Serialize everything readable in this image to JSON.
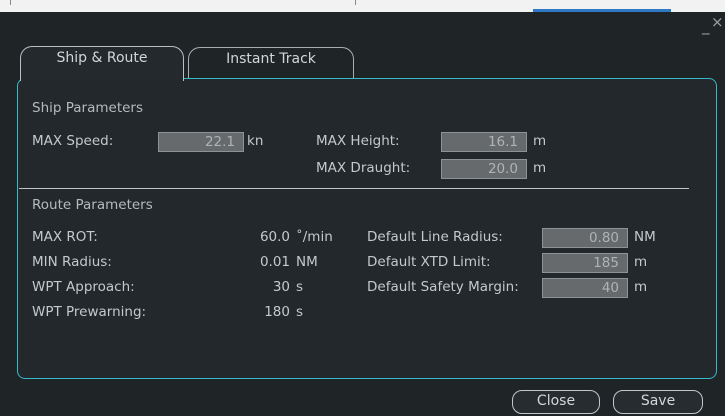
{
  "window": {
    "minimize_glyph": "_",
    "close_glyph": "×"
  },
  "tabs": [
    {
      "label": "Ship & Route",
      "active": true
    },
    {
      "label": "Instant Track",
      "active": false
    }
  ],
  "ship": {
    "section_title": "Ship Parameters",
    "max_speed": {
      "label": "MAX Speed:",
      "value": "22.1",
      "unit": "kn"
    },
    "max_height": {
      "label": "MAX Height:",
      "value": "16.1",
      "unit": "m"
    },
    "max_draught": {
      "label": "MAX Draught:",
      "value": "20.0",
      "unit": "m"
    }
  },
  "route": {
    "section_title": "Route Parameters",
    "max_rot": {
      "label": "MAX ROT:",
      "value": "60.0",
      "unit": "˚/min"
    },
    "min_radius": {
      "label": "MIN Radius:",
      "value": "0.01",
      "unit": "NM"
    },
    "wpt_approach": {
      "label": "WPT Approach:",
      "value": "30",
      "unit": "s"
    },
    "wpt_prewarning": {
      "label": "WPT Prewarning:",
      "value": "180",
      "unit": "s"
    },
    "default_line_radius": {
      "label": "Default Line Radius:",
      "value": "0.80",
      "unit": "NM"
    },
    "default_xtd_limit": {
      "label": "Default XTD Limit:",
      "value": "185",
      "unit": "m"
    },
    "default_safety_margin": {
      "label": "Default Safety Margin:",
      "value": "40",
      "unit": "m"
    }
  },
  "buttons": {
    "close": "Close",
    "save": "Save"
  }
}
